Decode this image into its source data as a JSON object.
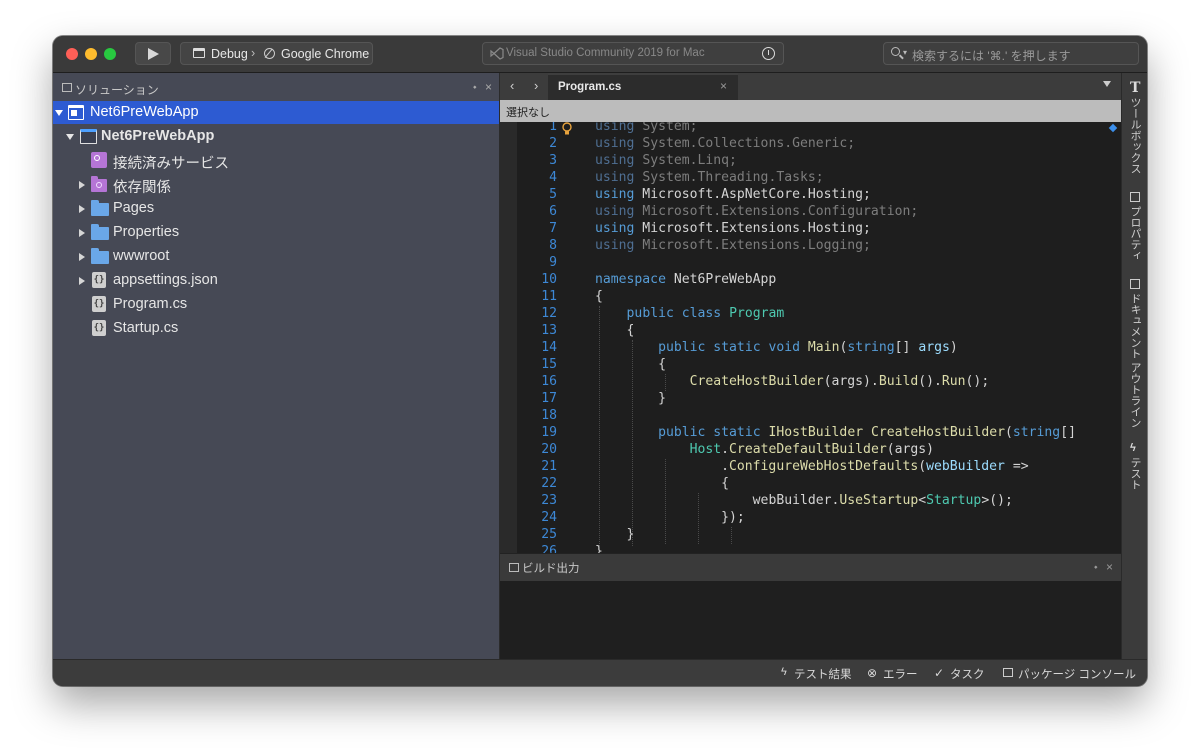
{
  "titlebar": {
    "config": "Debug",
    "breadcrumb_sep": "›",
    "target": "Google Chrome",
    "status": "Visual Studio Community 2019 for Mac",
    "search_placeholder": "検索するには '⌘.' を押します"
  },
  "solution_pad": {
    "title": "ソリューション",
    "pin": "⬩",
    "close": "×",
    "items": [
      {
        "label": "Net6PreWebApp",
        "icon": "solution-icon"
      },
      {
        "label": "Net6PreWebApp",
        "icon": "project-icon"
      },
      {
        "label": "接続済みサービス",
        "icon": "connected-services-icon"
      },
      {
        "label": "依存関係",
        "icon": "dependencies-folder-icon"
      },
      {
        "label": "Pages",
        "icon": "folder-icon"
      },
      {
        "label": "Properties",
        "icon": "folder-icon"
      },
      {
        "label": "wwwroot",
        "icon": "folder-icon"
      },
      {
        "label": "appsettings.json",
        "icon": "json-file-icon"
      },
      {
        "label": "Program.cs",
        "icon": "cs-file-icon"
      },
      {
        "label": "Startup.cs",
        "icon": "cs-file-icon"
      }
    ]
  },
  "editor": {
    "tab_label": "Program.cs",
    "tab_close": "×",
    "nav_back": "‹",
    "nav_forward": "›",
    "breadcrumb": "選択なし",
    "line_numbers": [
      "1",
      "2",
      "3",
      "4",
      "5",
      "6",
      "7",
      "8",
      "9",
      "10",
      "11",
      "12",
      "13",
      "14",
      "15",
      "16",
      "17",
      "18",
      "19",
      "20",
      "21",
      "22",
      "23",
      "24",
      "25",
      "26"
    ]
  },
  "build_output": {
    "title": "ビルド出力",
    "pin": "⬩",
    "close": "×"
  },
  "right_strip": {
    "toolbox": "ツールボックス",
    "properties": "プロパティ",
    "document_outline": "ドキュメント アウトライン",
    "test": "テスト"
  },
  "statusbar": {
    "test_results": "テスト結果",
    "errors": "エラー",
    "tasks": "タスク",
    "package_console": "パッケージ コンソール"
  },
  "colors": {
    "selection": "#2d5bd2",
    "keyword": "#569cd6",
    "type": "#4ec9b0",
    "method": "#dcdcaa",
    "line_number": "#3d88d6"
  }
}
